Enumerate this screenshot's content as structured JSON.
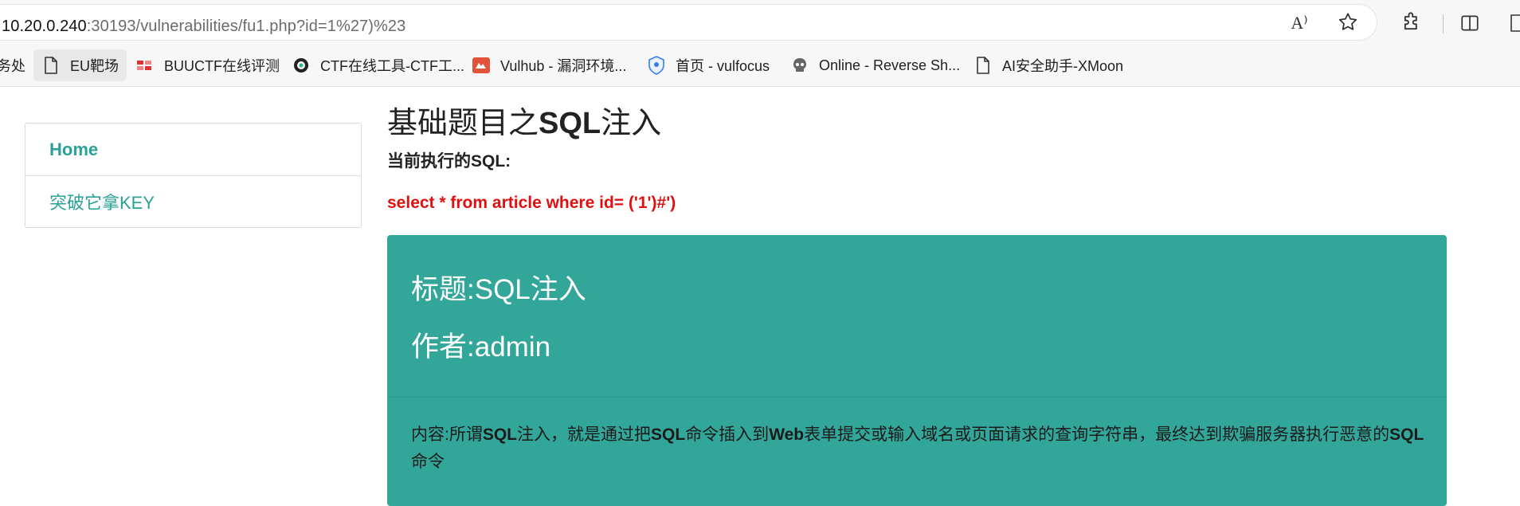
{
  "browser": {
    "url_host": "10.20.0.240",
    "url_path": ":30193/vulnerabilities/fu1.php?id=1%27)%23",
    "read_aloud_glyph": "A⁾"
  },
  "bookmarks": [
    {
      "label": "务处",
      "icon": "none"
    },
    {
      "label": "EU靶场",
      "icon": "document-icon"
    },
    {
      "label": "BUUCTF在线评测",
      "icon": "buuctf-logo-icon"
    },
    {
      "label": "CTF在线工具-CTF工...",
      "icon": "ctf-tools-icon"
    },
    {
      "label": "Vulhub - 漏洞环境...",
      "icon": "vulhub-icon"
    },
    {
      "label": "首页 - vulfocus",
      "icon": "vulfocus-shield-icon"
    },
    {
      "label": "Online - Reverse Sh...",
      "icon": "skull-icon"
    },
    {
      "label": "AI安全助手-XMoon",
      "icon": "document-icon"
    }
  ],
  "sidebar": {
    "items": [
      {
        "label": "Home"
      },
      {
        "label": "突破它拿KEY"
      }
    ]
  },
  "main": {
    "title_prefix": "基础题目之",
    "title_bold": "SQL",
    "title_suffix": "注入",
    "sql_heading": "当前执行的SQL:",
    "sql_query": "select * from article where id= ('1')#')"
  },
  "article": {
    "title_label": "标题:",
    "title_value": "SQL注入",
    "author_label": "作者:",
    "author_value": "admin",
    "content_label": "内容:",
    "content_parts": [
      "所谓",
      "SQL",
      "注入，就是通过把",
      "SQL",
      "命令插入到",
      "Web",
      "表单提交或输入域名或页面请求的查询字符串，最终达到欺骗服务器执行恶意的",
      "SQL",
      "命令"
    ]
  },
  "colors": {
    "accent_teal": "#33a69a",
    "link_teal": "#2aa198",
    "sql_red": "#e01010"
  }
}
